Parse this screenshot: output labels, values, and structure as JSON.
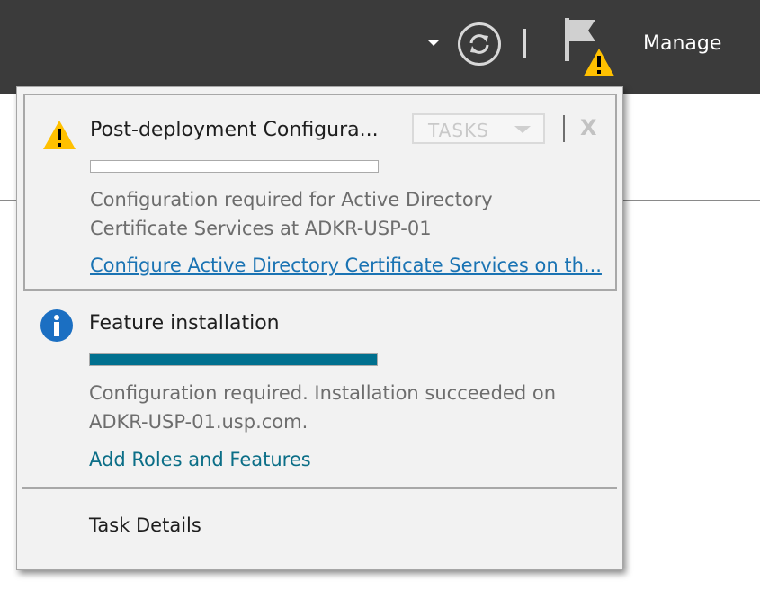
{
  "header": {
    "manage_label": "Manage",
    "icons": [
      "chevron-down-icon",
      "refresh-icon",
      "flag-icon",
      "warning-icon"
    ]
  },
  "notifications": [
    {
      "type": "warning",
      "icon": "warning-icon",
      "title": "Post-deployment Configura...",
      "tasks_label": "TASKS",
      "close_label": "X",
      "progress": 0,
      "message": "Configuration required for Active Directory Certificate Services at ADKR-USP-01",
      "link": "Configure Active Directory Certificate Services on th..."
    },
    {
      "type": "info",
      "icon": "info-icon",
      "title": "Feature installation",
      "progress": 1.0,
      "message": "Configuration required. Installation succeeded on ADKR-USP-01.usp.com.",
      "link": "Add Roles and Features"
    }
  ],
  "footer": {
    "task_details_label": "Task Details"
  },
  "colors": {
    "topbar": "#3b3b3b",
    "progress_fill": "#00708f",
    "link": "#1a73b3",
    "info_blue": "#1b6fc2",
    "warning_yellow": "#ffc000"
  }
}
